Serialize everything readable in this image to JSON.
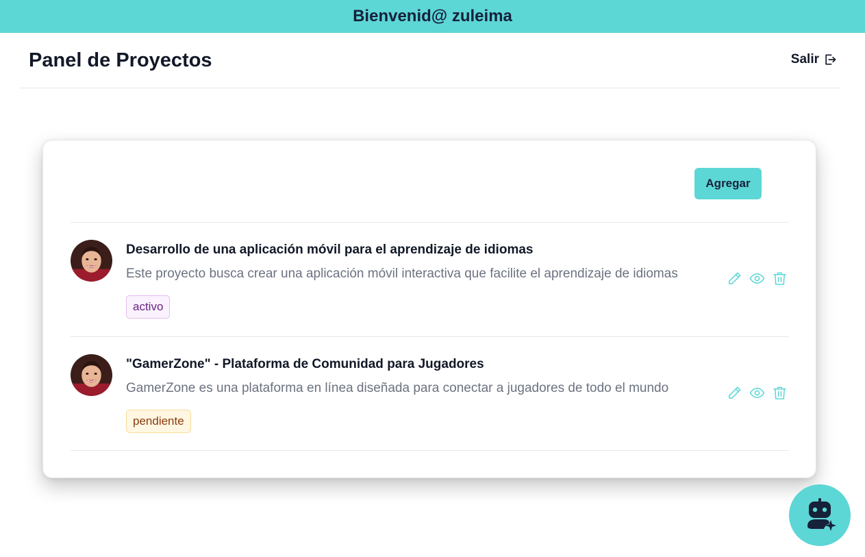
{
  "banner": {
    "greeting": "Bienvenid@ zuleima"
  },
  "header": {
    "title": "Panel de Proyectos",
    "logout_label": "Salir"
  },
  "card": {
    "add_label": "Agregar"
  },
  "projects": [
    {
      "title": "Desarrollo de una aplicación móvil para el aprendizaje de idiomas",
      "description": "Este proyecto busca crear una aplicación móvil interactiva que facilite el aprendizaje de idiomas",
      "status": "activo"
    },
    {
      "title": "\"GamerZone\" - Plataforma de Comunidad para Jugadores",
      "description": "GamerZone es una plataforma en línea diseñada para conectar a jugadores de todo el mundo",
      "status": "pendiente"
    }
  ],
  "icons": {
    "logout": "logout-icon",
    "edit": "pencil-icon",
    "view": "eye-icon",
    "delete": "trash-icon",
    "assistant": "robot-icon"
  },
  "colors": {
    "accent": "#5dd6d6",
    "action_icons": "#5dd6d6",
    "active_badge": "#6b2185",
    "pending_badge": "#8a3a10"
  }
}
